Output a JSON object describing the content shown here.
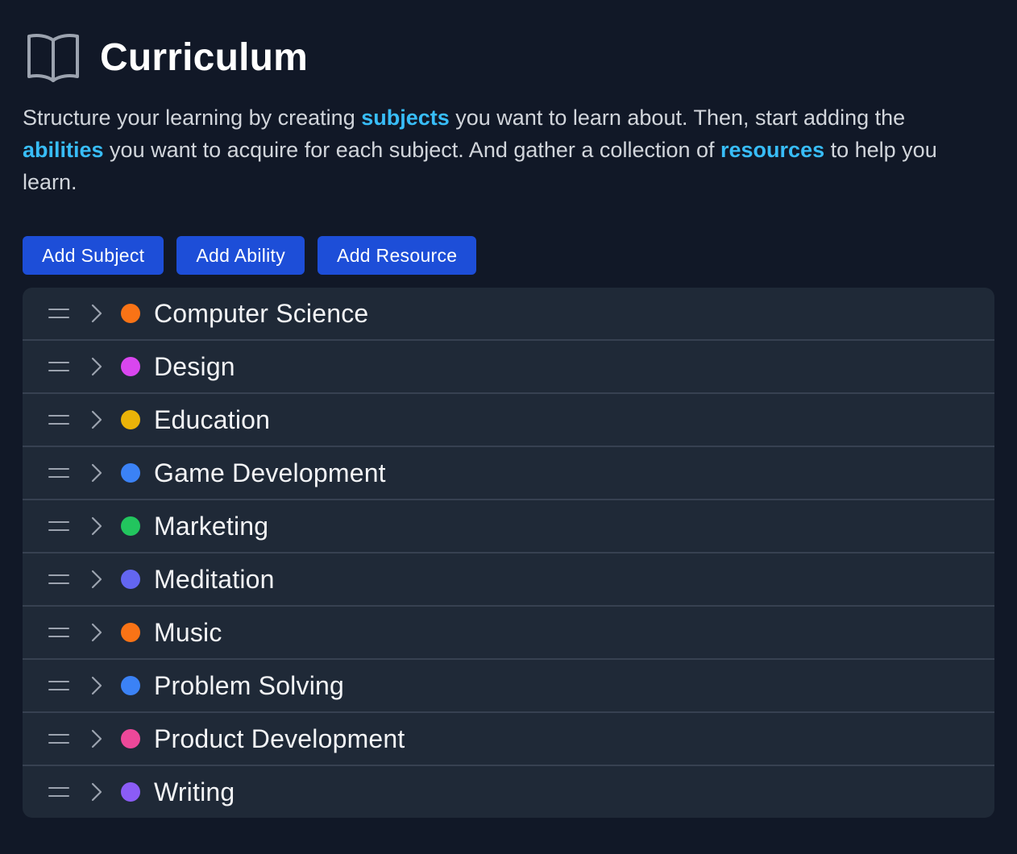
{
  "header": {
    "title": "Curriculum",
    "icon": "book-open-icon"
  },
  "intro": {
    "part1": "Structure your learning by creating ",
    "subjects": "subjects",
    "part2": " you want to learn about. Then, start adding the ",
    "abilities": "abilities",
    "part3": " you want to acquire for each subject. And gather a collection of ",
    "resources": "resources",
    "part4": " to help you learn."
  },
  "actions": {
    "add_subject": "Add Subject",
    "add_ability": "Add Ability",
    "add_resource": "Add Resource"
  },
  "subjects": [
    {
      "name": "Computer Science",
      "color": "#f97316"
    },
    {
      "name": "Design",
      "color": "#d946ef"
    },
    {
      "name": "Education",
      "color": "#eab308"
    },
    {
      "name": "Game Development",
      "color": "#3b82f6"
    },
    {
      "name": "Marketing",
      "color": "#22c55e"
    },
    {
      "name": "Meditation",
      "color": "#6366f1"
    },
    {
      "name": "Music",
      "color": "#f97316"
    },
    {
      "name": "Problem Solving",
      "color": "#3b82f6"
    },
    {
      "name": "Product Development",
      "color": "#ec4899"
    },
    {
      "name": "Writing",
      "color": "#8b5cf6"
    }
  ]
}
